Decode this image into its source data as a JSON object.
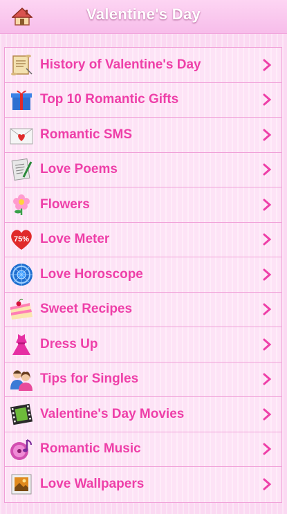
{
  "header": {
    "title": "Valentine's Day"
  },
  "menu": [
    {
      "label": "History of Valentine's Day",
      "icon": "scroll-icon"
    },
    {
      "label": "Top 10 Romantic Gifts",
      "icon": "gift-icon"
    },
    {
      "label": "Romantic SMS",
      "icon": "love-letter-icon"
    },
    {
      "label": "Love Poems",
      "icon": "poem-paper-icon"
    },
    {
      "label": "Flowers",
      "icon": "flower-icon"
    },
    {
      "label": "Love Meter",
      "icon": "heart-meter-icon",
      "badge": "75%"
    },
    {
      "label": "Love Horoscope",
      "icon": "zodiac-wheel-icon"
    },
    {
      "label": "Sweet Recipes",
      "icon": "cake-icon"
    },
    {
      "label": "Dress Up",
      "icon": "dress-icon"
    },
    {
      "label": "Tips for Singles",
      "icon": "couple-icon"
    },
    {
      "label": "Valentine's Day Movies",
      "icon": "film-strip-icon"
    },
    {
      "label": "Romantic Music",
      "icon": "music-icon"
    },
    {
      "label": "Love Wallpapers",
      "icon": "wallpaper-icon"
    }
  ],
  "colors": {
    "accent": "#ee3fa8",
    "background": "#fbd9f2",
    "border": "#f0a0d8"
  }
}
